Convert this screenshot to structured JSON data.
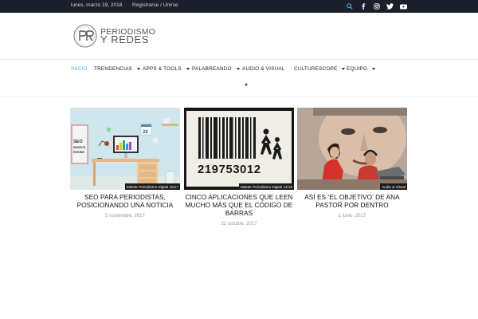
{
  "topbar": {
    "date": "lunes, marzo 19, 2018",
    "login": "Registrarse / Unirse",
    "icons": [
      "search-icon",
      "facebook-icon",
      "instagram-icon",
      "twitter-icon",
      "youtube-icon"
    ]
  },
  "logo": {
    "line1": "PERIODISMO",
    "line2": "Y REDES"
  },
  "nav": {
    "items": [
      {
        "label": "INICIO",
        "active": true
      },
      {
        "label": "TRENDENCIAS"
      },
      {
        "label": "APPS & TOOLS"
      },
      {
        "label": "PALABREANDO"
      },
      {
        "label": "AUDIO & VISUAL"
      },
      {
        "label": "CULTURESCOPE"
      },
      {
        "label": "EQUIPO"
      }
    ]
  },
  "posts": [
    {
      "category": "Máster Periodismo Digital 16/17",
      "title": "SEO PARA PERIODISTAS, POSICIONANDO UNA NOTICIA",
      "date": "5 noviembre, 2017",
      "image_text": [
        "SEO",
        "SEARCH",
        "ENGINE"
      ],
      "calendar_day": "28"
    },
    {
      "category": "Máster Periodismo Digital 14/15",
      "title": "CINCO APLICACIONES QUE LEEN MUCHO MÁS QUE EL CÓDIGO DE BARRAS",
      "date": "22 octubre, 2017",
      "barcode_number": "219753012"
    },
    {
      "category": "Audio & Visual",
      "title": "ASÍ ES ‘EL OBJETIVO’ DE ANA PASTOR POR DENTRO",
      "date": "1 junio, 2017"
    }
  ],
  "colors": {
    "topbar": "#1b1e2b",
    "accent": "#4db2ec",
    "category_bg": "#1b1b1b"
  }
}
